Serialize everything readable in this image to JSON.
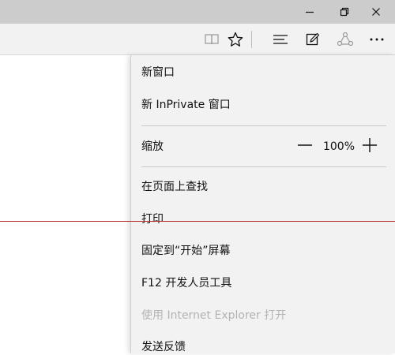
{
  "window_controls": {
    "minimize_icon": "minimize-icon",
    "restore_icon": "restore-icon",
    "close_icon": "close-icon"
  },
  "toolbar": {
    "icons": [
      "reading-view-icon",
      "favorite-star-icon",
      "hub-icon",
      "web-note-icon",
      "share-icon",
      "more-icon"
    ]
  },
  "menu": {
    "new_window": "新窗口",
    "new_inprivate": "新 InPrivate 窗口",
    "zoom_label": "缩放",
    "zoom_value": "100%",
    "find_on_page": "在页面上查找",
    "print": "打印",
    "pin_to_start": "固定到“开始”屏幕",
    "f12_tools": "F12 开发人员工具",
    "open_with_ie": "使用 Internet Explorer 打开",
    "send_feedback": "发送反馈"
  },
  "colors": {
    "titlebar": "#cccccc",
    "toolbar": "#f2f2f2",
    "menu_bg": "#f2f2f2",
    "disabled_text": "#b3b3b3",
    "accent_line": "#b22222"
  }
}
